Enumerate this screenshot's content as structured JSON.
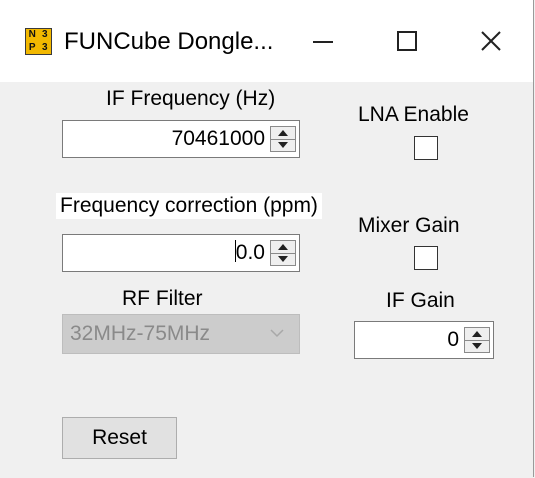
{
  "window": {
    "title": "FUNCube Dongle...",
    "icon_glyphs": [
      "N",
      "3",
      "P",
      "3"
    ],
    "controls": {
      "minimize": "minimize-icon",
      "maximize": "maximize-icon",
      "close": "close-icon"
    }
  },
  "if_frequency": {
    "label": "IF Frequency (Hz)",
    "value": "70461000"
  },
  "lna_enable": {
    "label": "LNA Enable",
    "checked": false
  },
  "frequency_correction": {
    "label": "Frequency correction (ppm)",
    "value": "0.0"
  },
  "mixer_gain": {
    "label": "Mixer Gain",
    "checked": false
  },
  "rf_filter": {
    "label": "RF Filter",
    "selected": "32MHz-75MHz",
    "disabled": true
  },
  "if_gain": {
    "label": "IF Gain",
    "value": "0"
  },
  "reset": {
    "label": "Reset"
  },
  "colors": {
    "titlebar": "#ffffff",
    "background": "#f0f0f0",
    "disabled_text": "#8a8a8a",
    "icon_bg": "#f2b800"
  }
}
